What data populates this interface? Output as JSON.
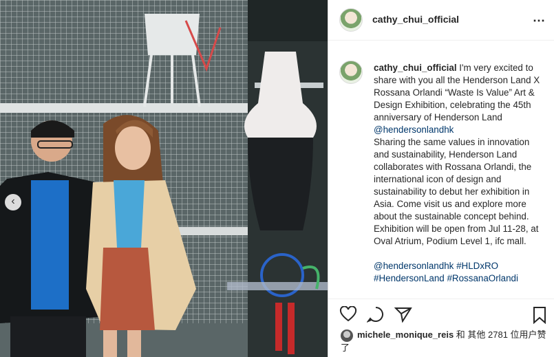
{
  "header": {
    "username": "cathy_chui_official",
    "more_icon": "more-horizontal-icon"
  },
  "caption": {
    "username": "cathy_chui_official",
    "p1": " I'm very excited to share with you all the Henderson Land X Rossana Orlandi “Waste Is Value” Art & Design Exhibition, celebrating the 45th anniversary of Henderson Land ",
    "mention1": "@hendersonlandhk",
    "p2": "Sharing the same values in innovation and sustainability, Henderson Land collaborates with Rossana Orlandi, the international icon of design and sustainability to debut her exhibition in Asia. Come visit us and explore more about the sustainable concept behind. Exhibition will be open from Jul 11-28, at Oval Atrium, Podium Level 1, ifc mall.",
    "tags": [
      "@hendersonlandhk",
      "#HLDxRO",
      "#HendersonLand",
      "#RossanaOrlandi"
    ]
  },
  "actions": {
    "like_icon": "heart-icon",
    "comment_icon": "comment-icon",
    "share_icon": "share-icon",
    "save_icon": "bookmark-icon"
  },
  "likes": {
    "user": "michele_monique_reis",
    "text": " 和 其他 2781 位用户赞了"
  }
}
